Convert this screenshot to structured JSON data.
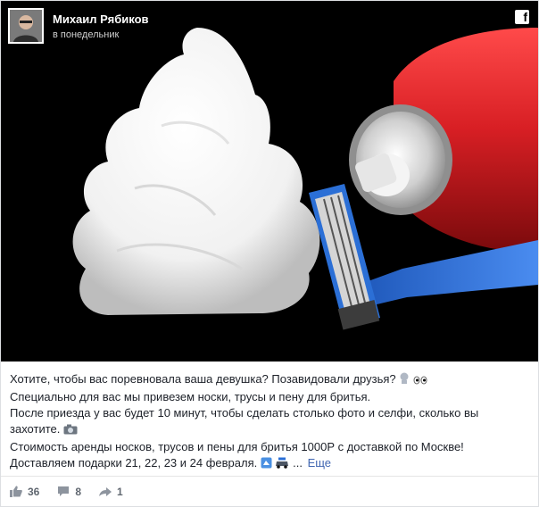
{
  "header": {
    "author_name": "Михаил Рябиков",
    "post_time": "в понедельник",
    "brand_icon": "facebook-icon",
    "brand_glyph": "f"
  },
  "post_text": {
    "line1": "Хотите, чтобы вас поревновала ваша девушка? Позавидовали друзья?",
    "line2": "Специально для вас мы привезем носки, трусы и пену для бритья.",
    "line3": "После приезда у вас будет 10 минут, чтобы сделать столько фото и селфи, сколько вы",
    "line4": "захотите.",
    "line5": "Стоимость аренды носков, трусов и пены для бритья 1000Р с доставкой по Москве!",
    "line6": "Доставляем подарки 21, 22, 23 и 24 февраля.",
    "more_ellipsis": "...",
    "more_link": "Еще"
  },
  "footer": {
    "likes": "36",
    "comments": "8",
    "shares": "1"
  },
  "colors": {
    "link": "#4267b2",
    "photo_bg": "#000000",
    "can_red": "#d81f24",
    "razor_blue": "#2b6fd6"
  }
}
